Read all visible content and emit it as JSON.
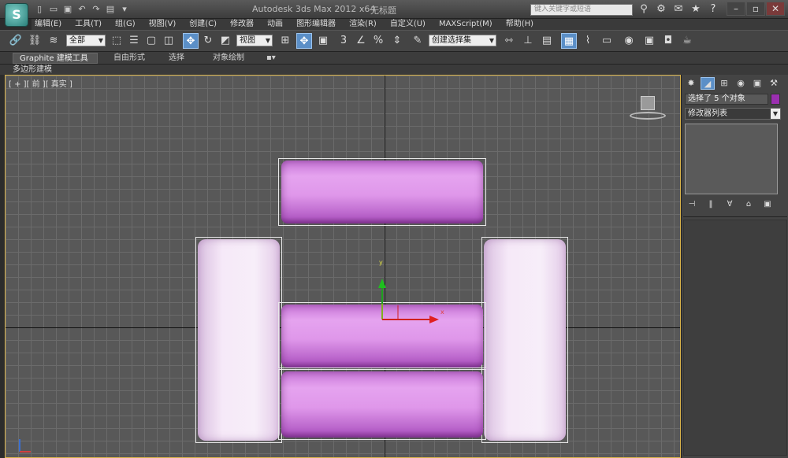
{
  "titlebar": {
    "app_title": "Autodesk 3ds Max  2012 x64",
    "doc_title": "无标题",
    "search_placeholder": "键入关键字或短语",
    "logo_glyph": "S"
  },
  "menu": [
    "编辑(E)",
    "工具(T)",
    "组(G)",
    "视图(V)",
    "创建(C)",
    "修改器",
    "动画",
    "图形编辑器",
    "渲染(R)",
    "自定义(U)",
    "MAXScript(M)",
    "帮助(H)"
  ],
  "toolbar": {
    "filter_value": "全部",
    "refcoord_value": "视图",
    "selection_set_value": "创建选择集",
    "snap_number": "3",
    "snap_percent": "%"
  },
  "ribbon": {
    "tabs": [
      "Graphite 建模工具",
      "自由形式",
      "选择",
      "对象绘制"
    ],
    "sub_label": "多边形建模"
  },
  "viewport": {
    "label": "[ + ][ 前 ][ 真实 ]",
    "gizmo_x": "x",
    "gizmo_y": "y",
    "object_color": "#d98ee8",
    "accent_border": "#d8b24a"
  },
  "command_panel": {
    "selection_text": "选择了 5 个对象",
    "modifier_list": "修改器列表",
    "swatch_color": "#9b2fb0"
  }
}
